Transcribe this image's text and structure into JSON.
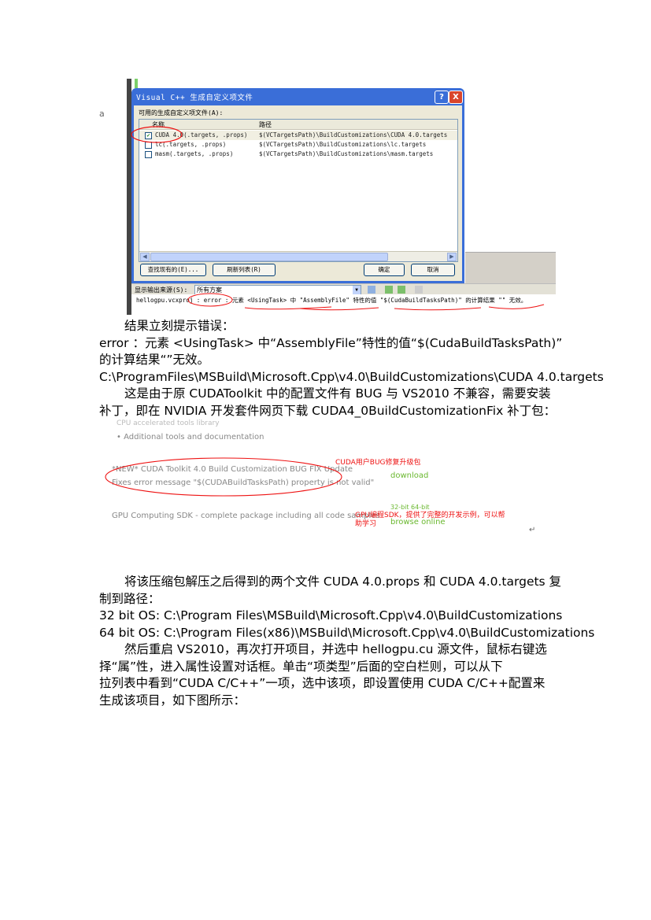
{
  "screenshot1": {
    "left_mark": "a",
    "dialog": {
      "title": "Visual C++ 生成自定义项文件",
      "help_button": "?",
      "close_button": "X",
      "group_label": "可用的生成自定义项文件(A):",
      "col_name": "名称",
      "col_path": "路径",
      "rows": [
        {
          "checked": true,
          "name": "CUDA 4.0(.targets, .props)",
          "path": "$(VCTargetsPath)\\BuildCustomizations\\CUDA 4.0.targets"
        },
        {
          "checked": false,
          "name": "lc(.targets, .props)",
          "path": "$(VCTargetsPath)\\BuildCustomizations\\lc.targets"
        },
        {
          "checked": false,
          "name": "masm(.targets, .props)",
          "path": "$(VCTargetsPath)\\BuildCustomizations\\masm.targets"
        }
      ],
      "find_existing_button": "查找现有的(E)...",
      "refresh_button": "刷新列表(R)",
      "ok_button": "确定",
      "cancel_button": "取消"
    },
    "ide_output_label": "显示输出来源(S):",
    "ide_output_source": "所有方案",
    "ide_error_line": "hellogpu.vcxproj : error : 元素 <UsingTask> 中 \"AssemblyFile\" 特性的值 \"$(CudaBuildTasksPath)\" 的计算结果 \"\" 无效。"
  },
  "paragraphs": {
    "p1": "结果立刻提示错误：",
    "p2_line1": "error   ：元素 <UsingTask> 中“AssemblyFile”特性的值“$(CudaBuildTasksPath)”",
    "p2_line2": "的计算结果“”无效。",
    "p3": "C:\\ProgramFiles\\MSBuild\\Microsoft.Cpp\\v4.0\\BuildCustomizations\\CUDA 4.0.targets",
    "p4_line1": "这是由于原 CUDAToolkit 中的配置文件有 BUG 与 VS2010 不兼容，需要安装",
    "p4_line2": "补丁，即在 NVIDIA 开发套件网页下载 CUDA4_0BuildCustomizationFix 补丁包："
  },
  "screenshot2": {
    "top_cut": "CPU accelerated tools library",
    "bullet": "Additional tools and documentation",
    "fix_line1": "*NEW* CUDA Toolkit 4.0 Build Customization BUG FIX Update",
    "fix_line2": "Fixes  error message \"$(CUDABuildTasksPath) property is not valid\"",
    "annot_red1": "CUDA用户BUG修复升级包",
    "download": "download",
    "sdk_line": "GPU Computing SDK - complete package including all code samples",
    "bit_note": "32-bit  64-bit",
    "annot_red2_line1": "GPU编程SDK，提供了完整的开发示例，可以帮",
    "annot_red2_line2": "助学习",
    "browse_online": "browse online",
    "para_mark": "↵"
  },
  "paragraphs2": {
    "p5_line1": "将该压缩包解压之后得到的两个文件 CUDA 4.0.props 和 CUDA 4.0.targets 复",
    "p5_line2": "制到路径：",
    "p6": "32 bit OS:     C:\\Program Files\\MSBuild\\Microsoft.Cpp\\v4.0\\BuildCustomizations",
    "p7": "64 bit OS:     C:\\Program Files(x86)\\MSBuild\\Microsoft.Cpp\\v4.0\\BuildCustomizations",
    "p8_line1": "然后重启 VS2010，再次打开项目，并选中 hellogpu.cu 源文件，鼠标右键选",
    "p8_line2": "择“属”性，进入属性设置对话框。单击“项类型”后面的空白栏则，可以从下",
    "p8_line3": "拉列表中看到“CUDA C/C++”一项，选中该项，即设置使用 CUDA C/C++配置来",
    "p8_line4": "生成该项目，如下图所示："
  },
  "colors": {
    "annotation_red": "#e11",
    "link_green": "#6ab82f",
    "xp_blue": "#3a6ed8"
  }
}
